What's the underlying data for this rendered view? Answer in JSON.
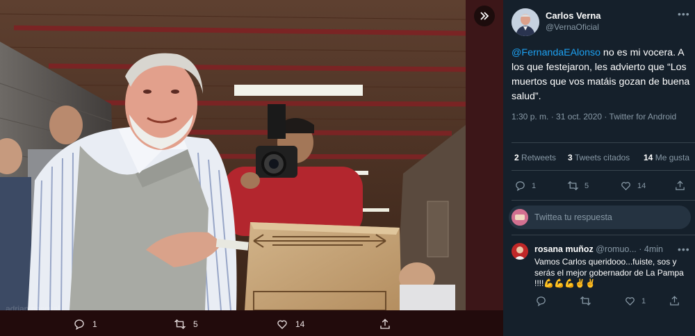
{
  "tweet": {
    "author_name": "Carlos Verna",
    "author_handle": "@VernaOficial",
    "mention": "@FernandaEAlonso",
    "text": " no es mi vocera. A los que festejaron, les advierto que “Los muertos que vos matáis gozan de buena salud”.",
    "timestamp": "1:30 p. m. · 31 oct. 2020 · Twitter for Android",
    "retweets_count": "2",
    "retweets_label": "Retweets",
    "quotes_count": "3",
    "quotes_label": "Tweets citados",
    "likes_count": "14",
    "likes_label": "Me gusta"
  },
  "panel_actions": {
    "reply_count": "1",
    "retweet_count": "5",
    "like_count": "14"
  },
  "media_actions": {
    "reply_count": "1",
    "retweet_count": "5",
    "like_count": "14"
  },
  "reply_box": {
    "placeholder": "Twittea tu respuesta"
  },
  "reply": {
    "author_name": "rosana muñoz",
    "author_handle": "@romuo...",
    "time": "· 4min",
    "text": "Vamos Carlos queridooo...fuiste, sos y serás el mejor gobernador de La Pampa !!!!",
    "emoji": "💪💪💪✌️✌️",
    "reply_count": "",
    "retweet_count": "",
    "like_count": "1"
  },
  "icons": {
    "expand": "double-chevron-right-icon",
    "reply": "speech-bubble-icon",
    "retweet": "retweet-arrows-icon",
    "like": "heart-icon",
    "share": "share-upload-icon",
    "more": "ellipsis-icon"
  },
  "colors": {
    "panel_bg": "#15202b",
    "accent": "#1da1f2",
    "muted": "#8899a6",
    "divider": "#38444d"
  }
}
